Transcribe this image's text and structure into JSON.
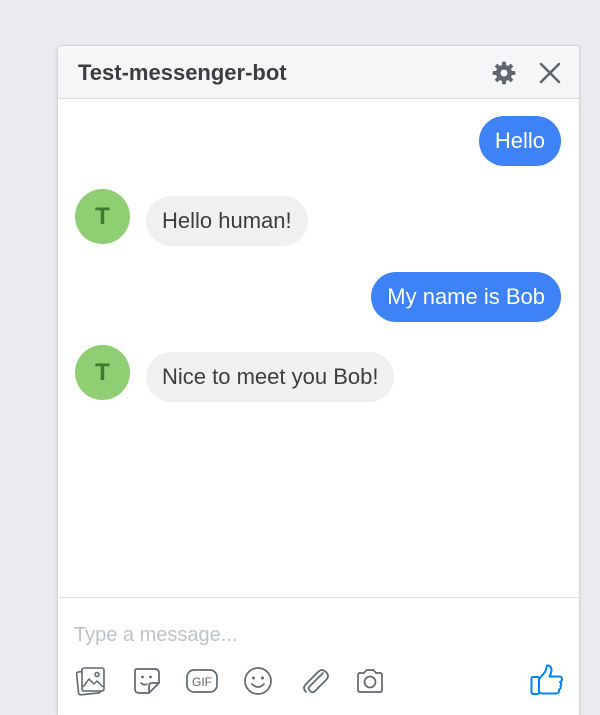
{
  "header": {
    "title": "Test-messenger-bot",
    "settings_icon": "gear-icon",
    "close_icon": "close-icon"
  },
  "messages": [
    {
      "from": "user",
      "text": "Hello"
    },
    {
      "from": "bot",
      "avatar_letter": "T",
      "text": "Hello human!"
    },
    {
      "from": "user",
      "text": "My name is Bob"
    },
    {
      "from": "bot",
      "avatar_letter": "T",
      "text": "Nice to meet you Bob!"
    }
  ],
  "composer": {
    "placeholder": "Type a message...",
    "value": "",
    "tools": [
      "photo-icon",
      "sticker-icon",
      "gif-icon",
      "emoji-icon",
      "attachment-icon",
      "camera-icon"
    ],
    "gif_label": "GIF",
    "send_icon": "thumbs-up-icon"
  },
  "colors": {
    "outgoing_bubble": "#3e82f7",
    "incoming_bubble": "#f1f0f0",
    "avatar": "#8fce73",
    "accent": "#0084ff"
  }
}
